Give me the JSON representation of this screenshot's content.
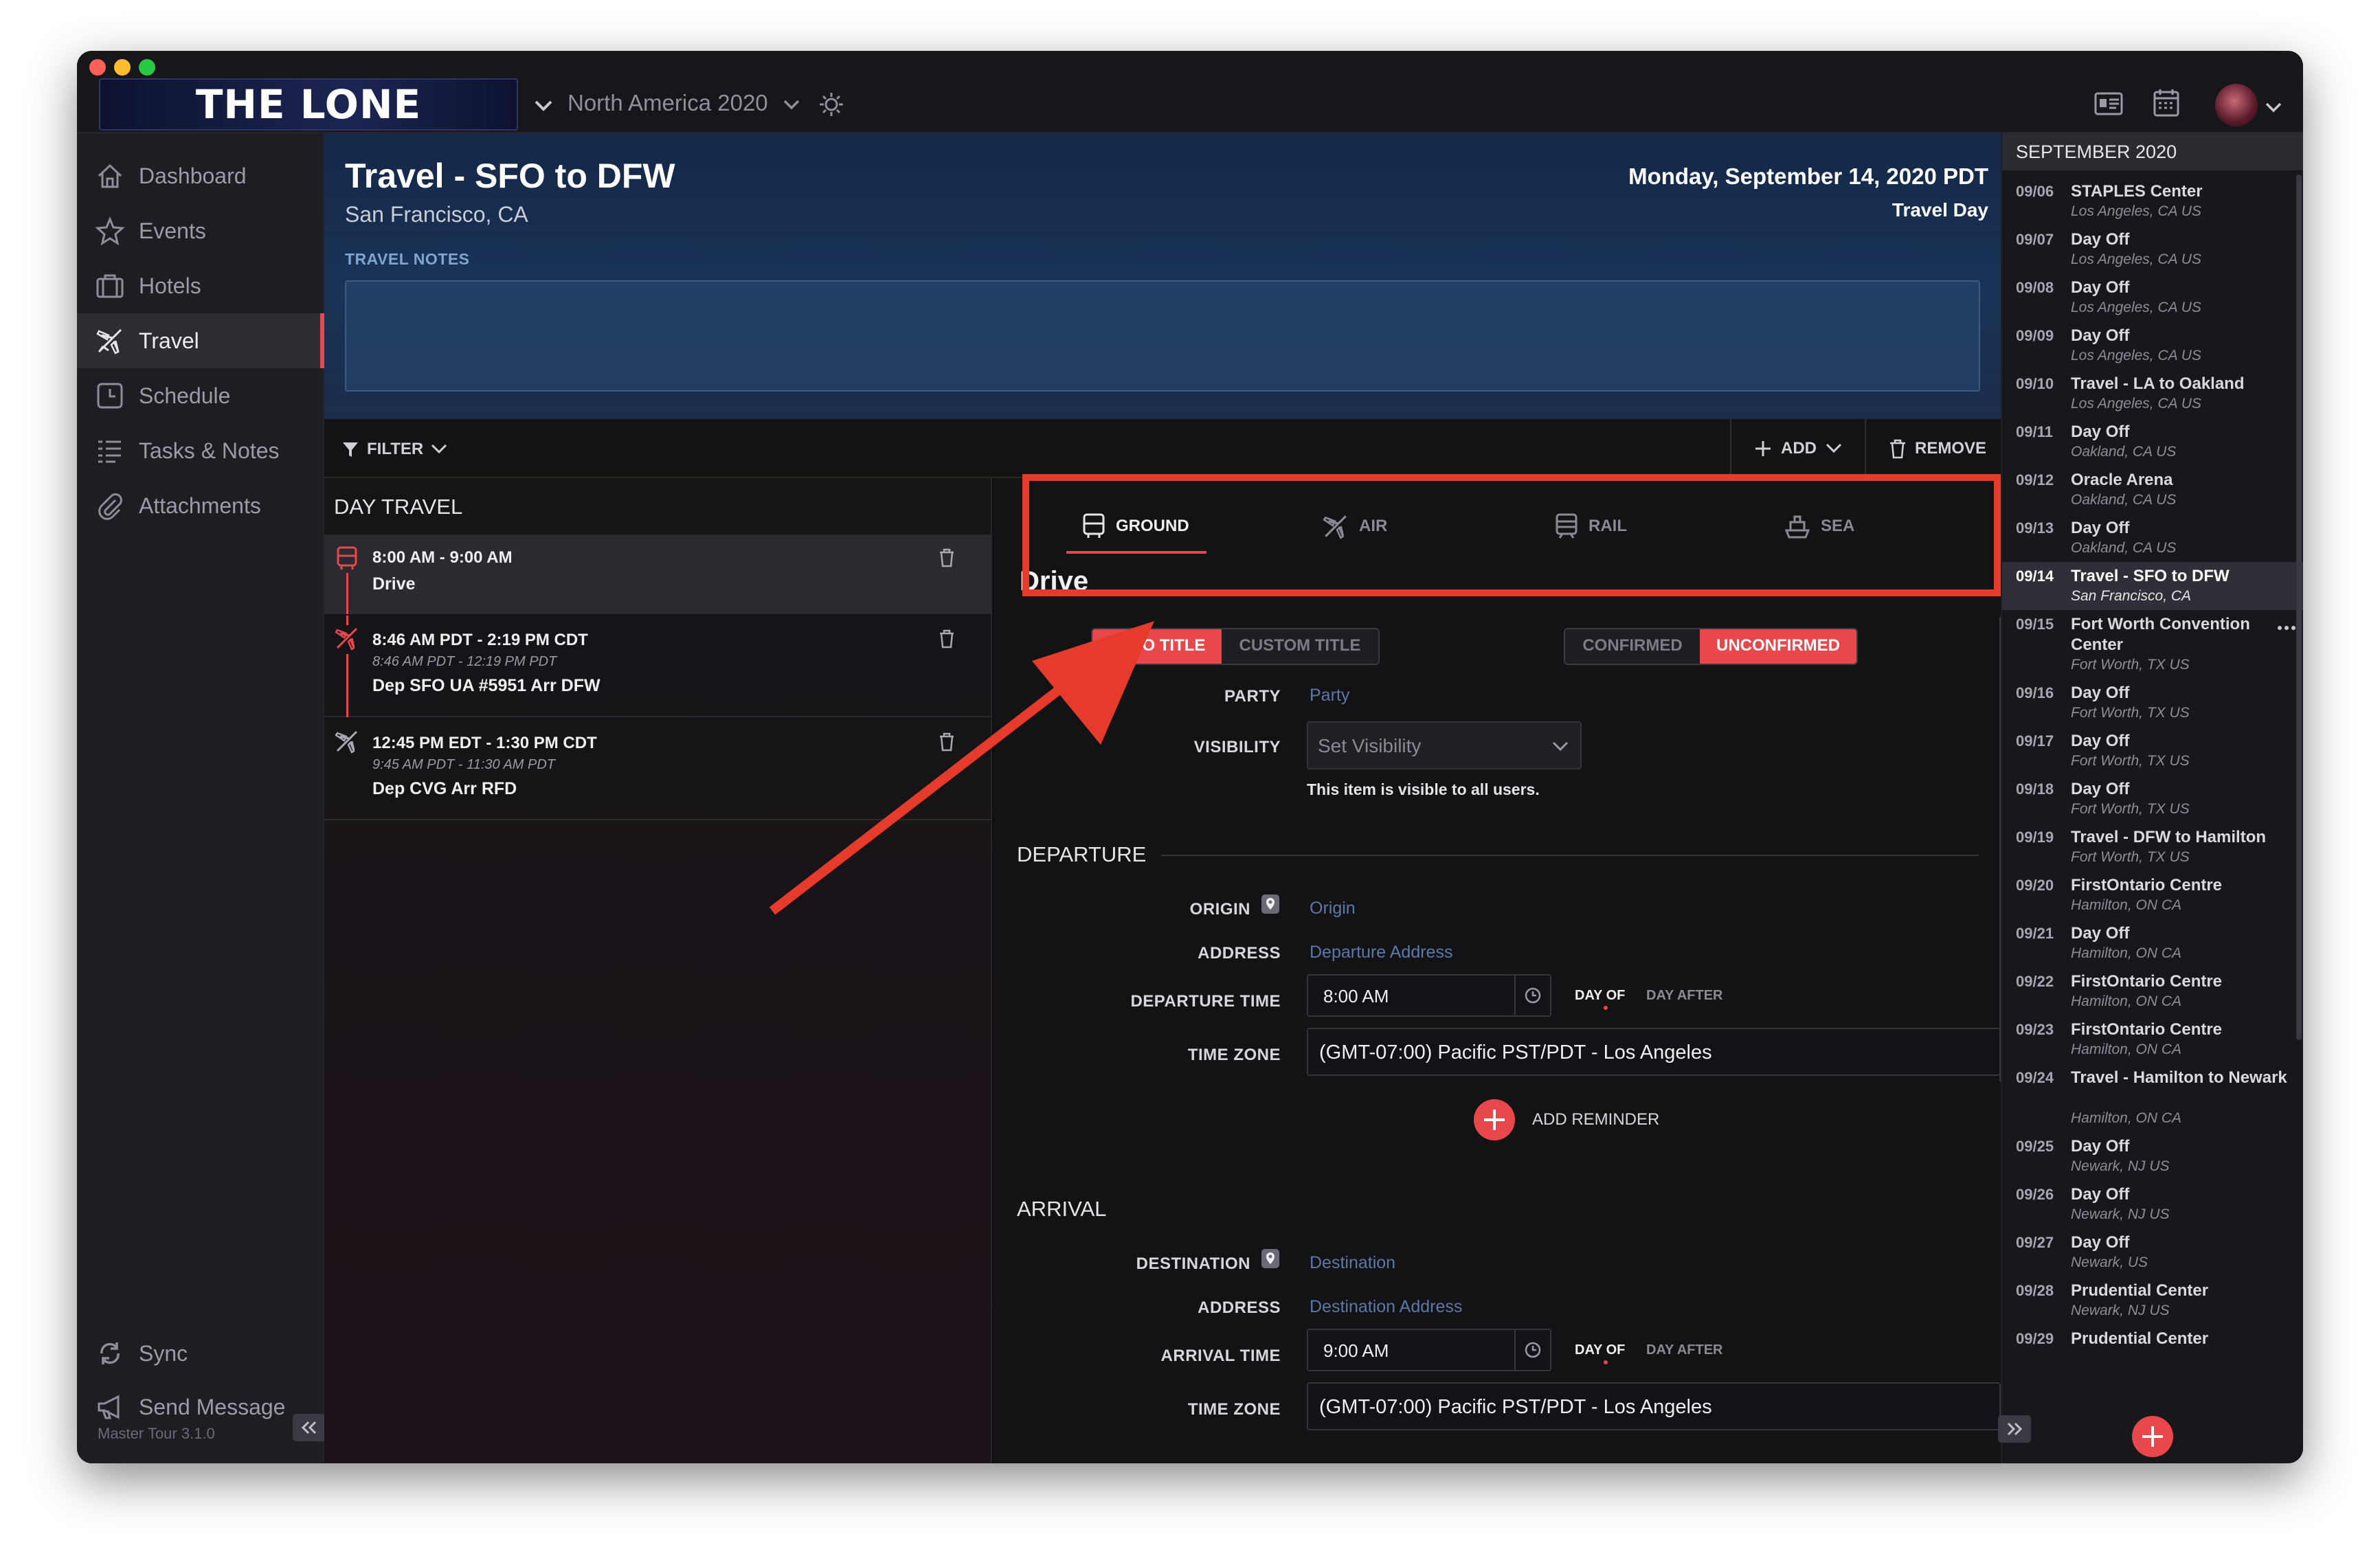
{
  "app": {
    "brand": "THE LONE RANGERS",
    "tour_name": "North America 2020",
    "version": "Master Tour 3.1.0"
  },
  "nav": {
    "items": [
      {
        "label": "Dashboard",
        "icon": "home-icon"
      },
      {
        "label": "Events",
        "icon": "star-icon"
      },
      {
        "label": "Hotels",
        "icon": "suitcase-icon"
      },
      {
        "label": "Travel",
        "icon": "plane-icon"
      },
      {
        "label": "Schedule",
        "icon": "clock-icon"
      },
      {
        "label": "Tasks & Notes",
        "icon": "list-icon"
      },
      {
        "label": "Attachments",
        "icon": "paperclip-icon"
      }
    ],
    "active": "Travel",
    "sync_label": "Sync",
    "send_message_label": "Send Message"
  },
  "header": {
    "title": "Travel - SFO to DFW",
    "subtitle": "San Francisco, CA",
    "date": "Monday, September 14, 2020 PDT",
    "day_type": "Travel Day",
    "notes_label": "TRAVEL NOTES"
  },
  "toolbar": {
    "filter_label": "FILTER",
    "add_label": "ADD",
    "remove_label": "REMOVE"
  },
  "day_travel": {
    "heading": "DAY TRAVEL",
    "items": [
      {
        "time": "8:00 AM - 9:00 AM",
        "secondary": "",
        "desc": "Drive",
        "type": "ground"
      },
      {
        "time": "8:46 AM PDT - 2:19 PM CDT",
        "secondary": "8:46 AM PDT - 12:19 PM PDT",
        "desc": "Dep SFO UA #5951 Arr DFW",
        "type": "air"
      },
      {
        "time": "12:45 PM EDT - 1:30 PM CDT",
        "secondary": "9:45 AM PDT - 11:30 AM PDT",
        "desc": "Dep CVG Arr RFD",
        "type": "air"
      }
    ]
  },
  "tabs": {
    "ground": "GROUND",
    "air": "AIR",
    "rail": "RAIL",
    "sea": "SEA",
    "active": "GROUND"
  },
  "detail": {
    "title": "Drive",
    "auto_title": "AUTO TITLE",
    "custom_title": "CUSTOM TITLE",
    "confirmed": "CONFIRMED",
    "unconfirmed": "UNCONFIRMED",
    "party_label": "PARTY",
    "party_placeholder": "Party",
    "visibility_label": "VISIBILITY",
    "visibility_placeholder": "Set Visibility",
    "visibility_note": "This item is visible to all users.",
    "departure": {
      "heading": "DEPARTURE",
      "origin_label": "ORIGIN",
      "origin_placeholder": "Origin",
      "address_label": "ADDRESS",
      "address_placeholder": "Departure Address",
      "time_label": "DEPARTURE TIME",
      "time_value": "8:00 AM",
      "day_of": "DAY OF",
      "day_after": "DAY AFTER",
      "tz_label": "TIME ZONE",
      "tz_value": "(GMT-07:00) Pacific PST/PDT - Los Angeles"
    },
    "add_reminder": "ADD REMINDER",
    "arrival": {
      "heading": "ARRIVAL",
      "dest_label": "DESTINATION",
      "dest_placeholder": "Destination",
      "address_label": "ADDRESS",
      "address_placeholder": "Destination Address",
      "time_label": "ARRIVAL TIME",
      "time_value": "9:00 AM",
      "day_of": "DAY OF",
      "day_after": "DAY AFTER",
      "tz_label": "TIME ZONE",
      "tz_value": "(GMT-07:00) Pacific PST/PDT - Los Angeles"
    }
  },
  "calendar": {
    "month": "SEPTEMBER 2020",
    "entries": [
      {
        "date": "09/06",
        "title": "STAPLES Center",
        "loc": "Los Angeles, CA US"
      },
      {
        "date": "09/07",
        "title": "Day Off",
        "loc": "Los Angeles, CA US"
      },
      {
        "date": "09/08",
        "title": "Day Off",
        "loc": "Los Angeles, CA US"
      },
      {
        "date": "09/09",
        "title": "Day Off",
        "loc": "Los Angeles, CA US"
      },
      {
        "date": "09/10",
        "title": "Travel - LA to Oakland",
        "loc": "Los Angeles, CA US"
      },
      {
        "date": "09/11",
        "title": "Day Off",
        "loc": "Oakland, CA US"
      },
      {
        "date": "09/12",
        "title": "Oracle Arena",
        "loc": "Oakland, CA US"
      },
      {
        "date": "09/13",
        "title": "Day Off",
        "loc": "Oakland, CA US"
      },
      {
        "date": "09/14",
        "title": "Travel - SFO to DFW",
        "loc": "San Francisco, CA"
      },
      {
        "date": "09/15",
        "title": "Fort Worth Convention Center",
        "loc": "Fort Worth, TX US"
      },
      {
        "date": "09/16",
        "title": "Day Off",
        "loc": "Fort Worth, TX US"
      },
      {
        "date": "09/17",
        "title": "Day Off",
        "loc": "Fort Worth, TX US"
      },
      {
        "date": "09/18",
        "title": "Day Off",
        "loc": "Fort Worth, TX US"
      },
      {
        "date": "09/19",
        "title": "Travel - DFW to Hamilton",
        "loc": "Fort Worth, TX US"
      },
      {
        "date": "09/20",
        "title": "FirstOntario Centre",
        "loc": "Hamilton, ON CA"
      },
      {
        "date": "09/21",
        "title": "Day Off",
        "loc": "Hamilton, ON CA"
      },
      {
        "date": "09/22",
        "title": "FirstOntario Centre",
        "loc": "Hamilton, ON CA"
      },
      {
        "date": "09/23",
        "title": "FirstOntario Centre",
        "loc": "Hamilton, ON CA"
      },
      {
        "date": "09/24",
        "title": "Travel - Hamilton to Newark",
        "loc": "Hamilton, ON CA"
      },
      {
        "date": "09/25",
        "title": "Day Off",
        "loc": "Newark, NJ US"
      },
      {
        "date": "09/26",
        "title": "Day Off",
        "loc": "Newark, NJ US"
      },
      {
        "date": "09/27",
        "title": "Day Off",
        "loc": "Newark, US"
      },
      {
        "date": "09/28",
        "title": "Prudential Center",
        "loc": "Newark, NJ US"
      },
      {
        "date": "09/29",
        "title": "Prudential Center",
        "loc": ""
      }
    ],
    "selected": "09/14"
  },
  "colors": {
    "accent_red": "#e8474c",
    "annotation_red": "#e63a2a",
    "link_blue": "#5a78a8",
    "header_blue": "#1a3357"
  }
}
